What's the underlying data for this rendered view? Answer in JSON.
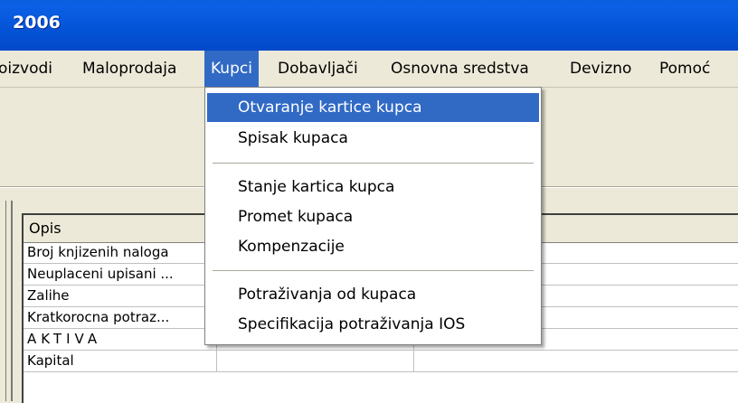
{
  "window": {
    "title": "2006"
  },
  "menubar": {
    "items": [
      {
        "label": "oizvodi"
      },
      {
        "label": "Maloprodaja"
      },
      {
        "label": "Kupci",
        "active": true
      },
      {
        "label": "Dobavljači"
      },
      {
        "label": "Osnovna sredstva"
      },
      {
        "label": "Devizno"
      },
      {
        "label": "Pomoć"
      }
    ]
  },
  "dropdown": {
    "groups": [
      [
        "Otvaranje kartice kupca",
        "Spisak kupaca"
      ],
      [
        "Stanje kartica kupca",
        "Promet kupaca",
        "Kompenzacije"
      ],
      [
        "Potraživanja od kupaca",
        "Specifikacija potraživanja IOS"
      ]
    ],
    "highlighted": "Otvaranje kartice kupca"
  },
  "grid": {
    "columns": [
      "Opis",
      "",
      ""
    ],
    "rows": [
      [
        "Broj knjizenih naloga",
        "",
        ""
      ],
      [
        "Neuplaceni upisani ...",
        "",
        ""
      ],
      [
        "Zalihe",
        "",
        ""
      ],
      [
        "Kratkorocna potraz...",
        "",
        ""
      ],
      [
        "AKTIVA",
        "",
        ""
      ],
      [
        "Kapital",
        "",
        ""
      ]
    ]
  },
  "colors": {
    "titlebar": "#0453d6",
    "highlight": "#316ac5",
    "chrome": "#ece9d8"
  }
}
